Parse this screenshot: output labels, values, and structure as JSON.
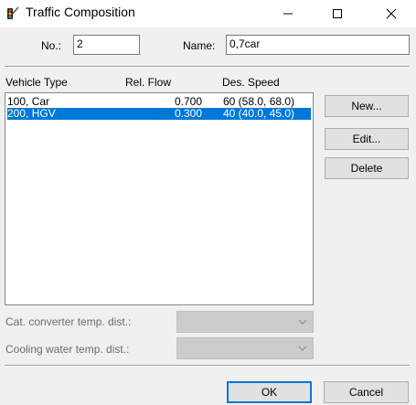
{
  "window": {
    "title": "Traffic Composition",
    "icon": "traffic-light-icon",
    "minimize_icon": "minimize-icon",
    "maximize_icon": "maximize-icon",
    "close_icon": "close-icon"
  },
  "form": {
    "no_label": "No.:",
    "no_value": "2",
    "name_label": "Name:",
    "name_value": "0,7car"
  },
  "list": {
    "columns": [
      "Vehicle Type",
      "Rel. Flow",
      "Des. Speed"
    ],
    "rows": [
      {
        "type": "100, Car",
        "flow": "0.700",
        "speed": "60 (58.0, 68.0)",
        "selected": false
      },
      {
        "type": "200, HGV",
        "flow": "0.300",
        "speed": "40 (40.0, 45.0)",
        "selected": true
      }
    ],
    "selection_color": "#0078d7"
  },
  "side_buttons": {
    "new": "New...",
    "edit": "Edit...",
    "delete": "Delete"
  },
  "temps": {
    "cat_converter_label": "Cat. converter temp. dist.:",
    "cooling_water_label": "Cooling water temp. dist.:"
  },
  "footer": {
    "ok": "OK",
    "cancel": "Cancel"
  }
}
